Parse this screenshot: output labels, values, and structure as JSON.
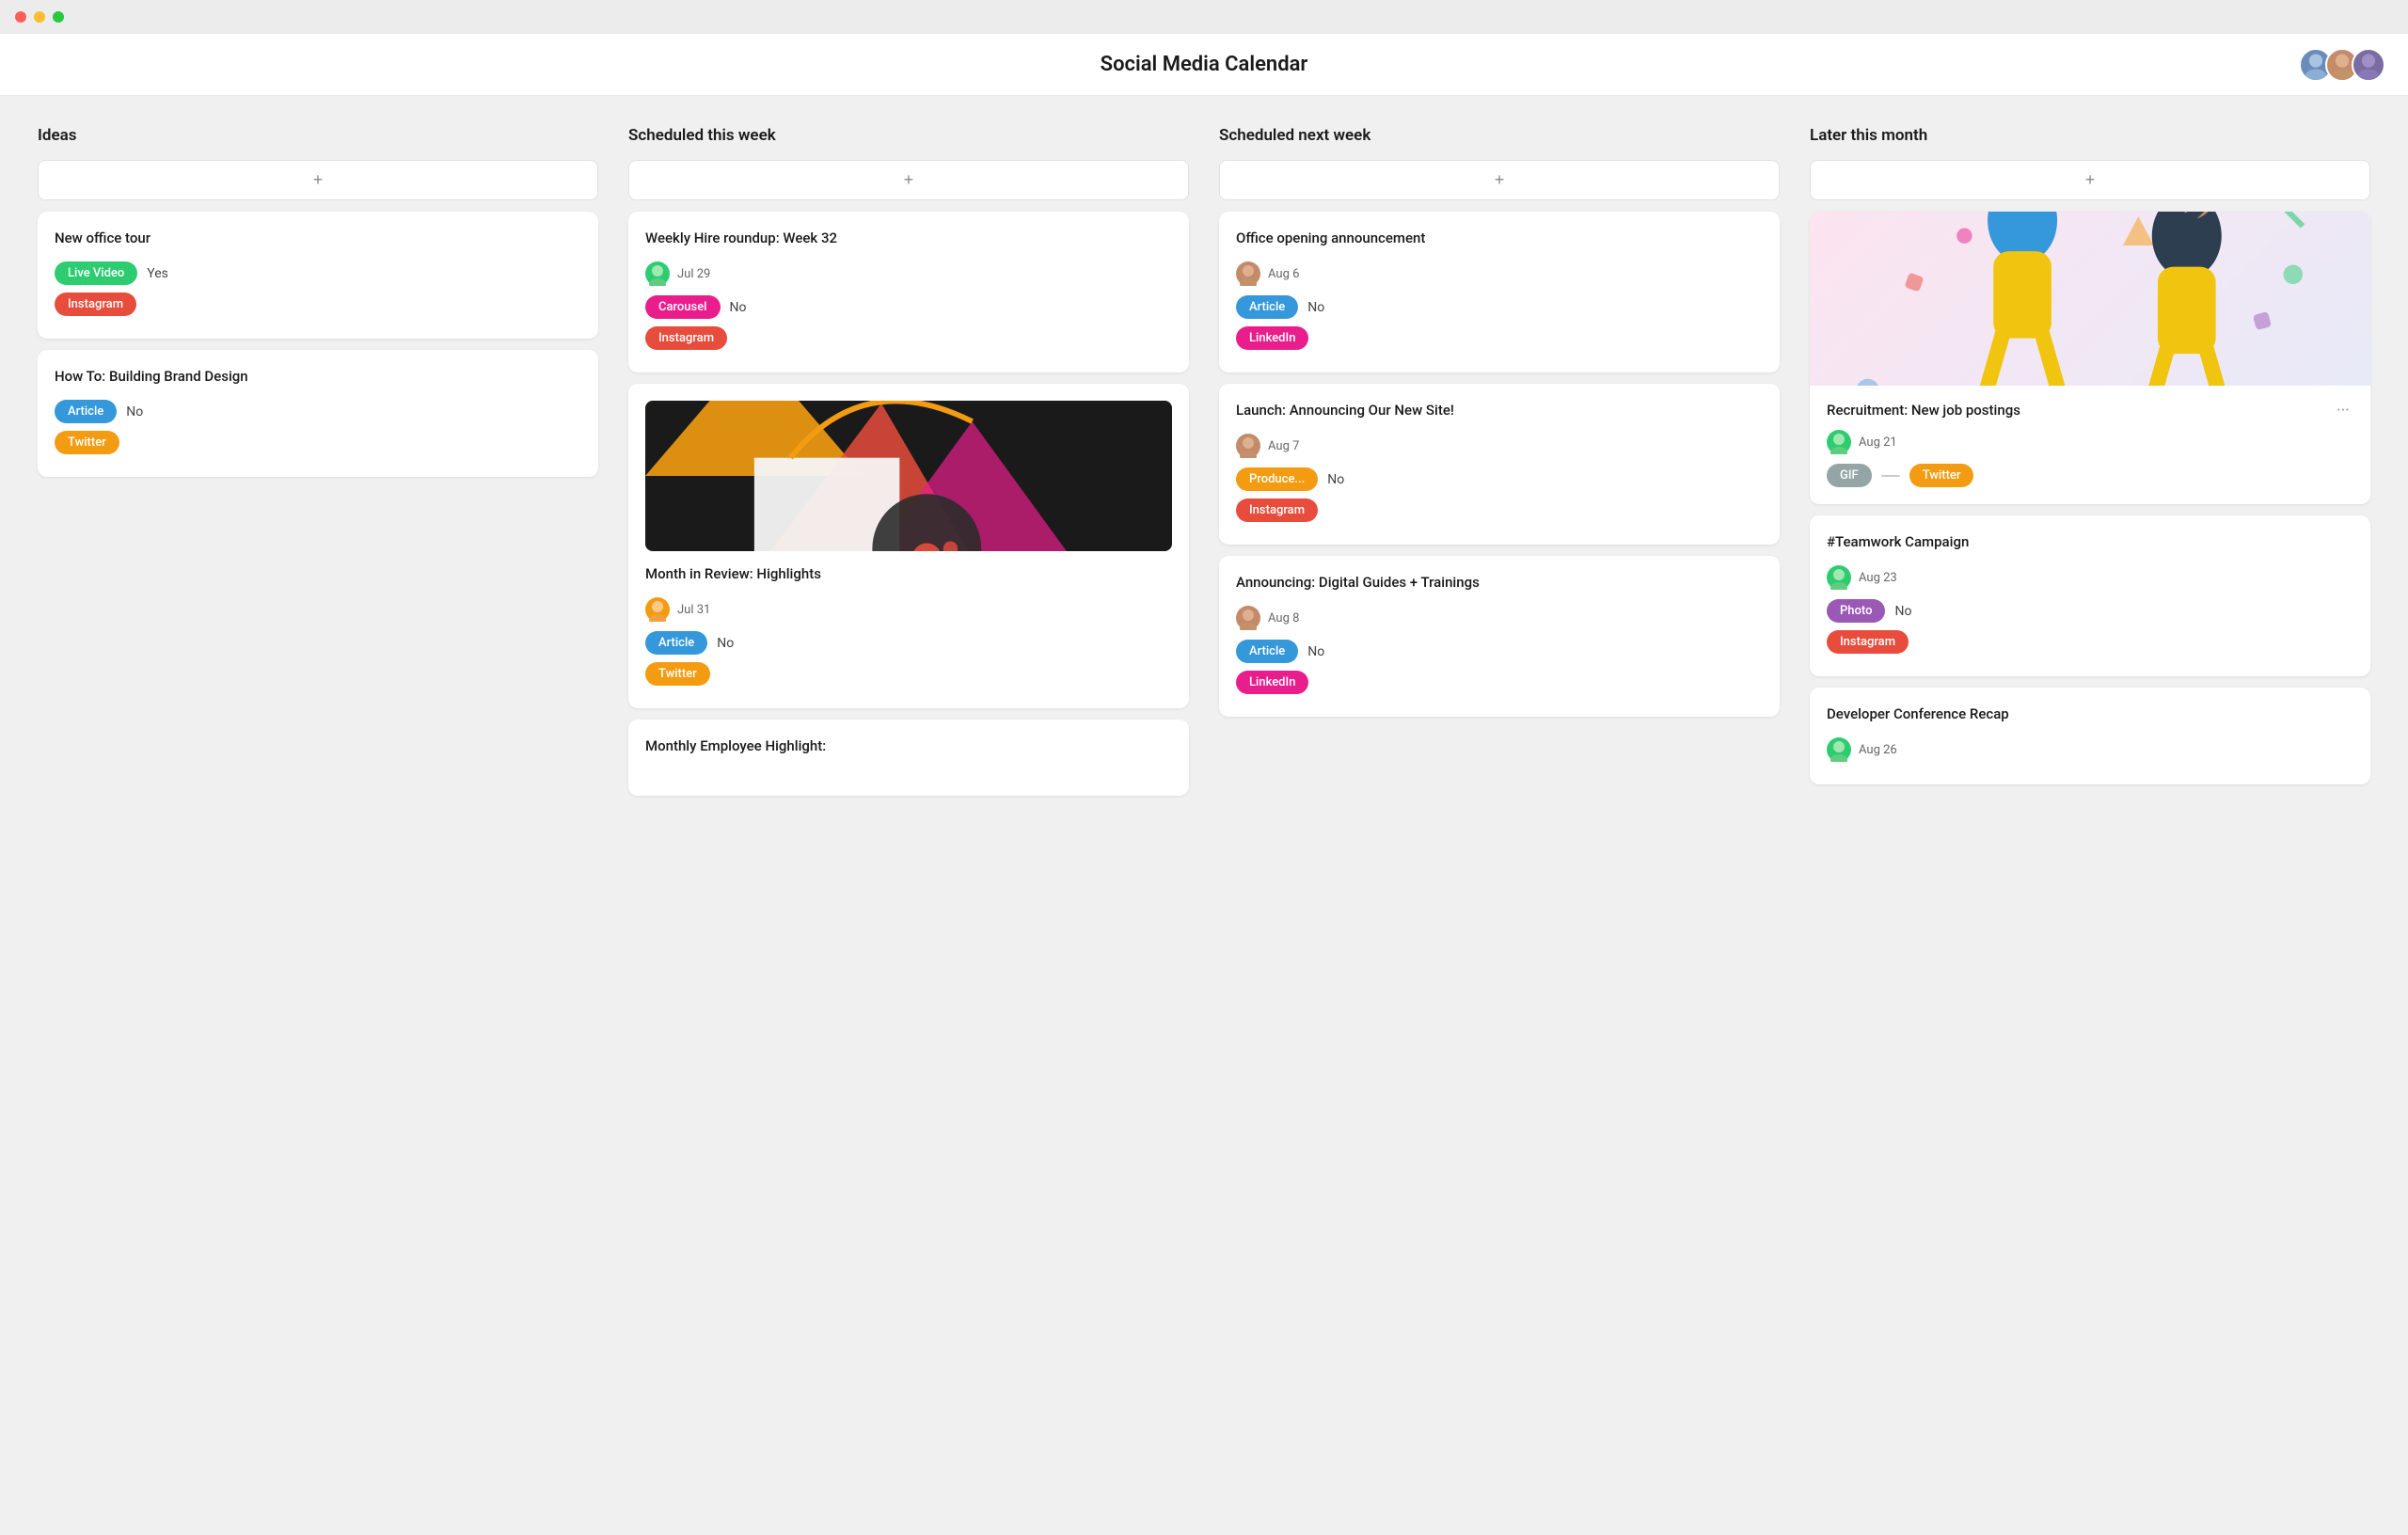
{
  "titlebar": {
    "dots": [
      "red",
      "yellow",
      "green"
    ]
  },
  "header": {
    "title": "Social Media Calendar",
    "avatars": [
      {
        "color": "#6b8cba",
        "label": "A1"
      },
      {
        "color": "#c48a6a",
        "label": "A2"
      },
      {
        "color": "#7a6ba0",
        "label": "A3"
      }
    ]
  },
  "columns": [
    {
      "id": "ideas",
      "title": "Ideas",
      "add_label": "+",
      "cards": [
        {
          "id": "new-office-tour",
          "title": "New office tour",
          "tags": [
            {
              "label": "Live Video",
              "type": "live-video"
            },
            {
              "label": "Instagram",
              "type": "instagram"
            }
          ],
          "boolean_label": "Yes",
          "has_meta": false
        },
        {
          "id": "building-brand",
          "title": "How To: Building Brand Design",
          "tags": [
            {
              "label": "Article",
              "type": "article"
            },
            {
              "label": "Twitter",
              "type": "twitter"
            }
          ],
          "boolean_label": "No",
          "has_meta": false
        }
      ]
    },
    {
      "id": "scheduled-this-week",
      "title": "Scheduled this week",
      "add_label": "+",
      "cards": [
        {
          "id": "weekly-hire",
          "title": "Weekly Hire roundup: Week 32",
          "avatar_color": "#2ecc71",
          "date": "Jul 29",
          "tags": [
            {
              "label": "Carousel",
              "type": "carousel"
            },
            {
              "label": "Instagram",
              "type": "instagram"
            }
          ],
          "boolean_label": "No",
          "has_meta": true,
          "has_image": false
        },
        {
          "id": "month-review",
          "title": "Month in Review: Highlights",
          "avatar_color": "#f39c12",
          "date": "Jul 31",
          "tags": [
            {
              "label": "Article",
              "type": "article"
            },
            {
              "label": "Twitter",
              "type": "twitter"
            }
          ],
          "boolean_label": "No",
          "has_meta": true,
          "has_image": true,
          "image_type": "art1"
        },
        {
          "id": "monthly-employee",
          "title": "Monthly Employee Highlight:",
          "has_meta": false,
          "has_image": false,
          "partial": true
        }
      ]
    },
    {
      "id": "scheduled-next-week",
      "title": "Scheduled next week",
      "add_label": "+",
      "cards": [
        {
          "id": "office-opening",
          "title": "Office opening announcement",
          "avatar_color": "#c48a6a",
          "date": "Aug 6",
          "tags": [
            {
              "label": "Article",
              "type": "article"
            },
            {
              "label": "LinkedIn",
              "type": "linkedin"
            }
          ],
          "boolean_label": "No",
          "has_meta": true
        },
        {
          "id": "launch-new-site",
          "title": "Launch: Announcing Our New Site!",
          "avatar_color": "#c48a6a",
          "date": "Aug 7",
          "tags": [
            {
              "label": "Produce...",
              "type": "produce"
            },
            {
              "label": "Instagram",
              "type": "instagram"
            }
          ],
          "boolean_label": "No",
          "has_meta": true
        },
        {
          "id": "digital-guides",
          "title": "Announcing: Digital Guides + Trainings",
          "avatar_color": "#c48a6a",
          "date": "Aug 8",
          "tags": [
            {
              "label": "Article",
              "type": "article"
            },
            {
              "label": "LinkedIn",
              "type": "linkedin"
            }
          ],
          "boolean_label": "No",
          "has_meta": true,
          "has_image": false
        }
      ]
    },
    {
      "id": "later-this-month",
      "title": "Later this month",
      "add_label": "+",
      "cards": [
        {
          "id": "recruitment",
          "title": "Recruitment: New job postings",
          "avatar_color": "#2ecc71",
          "date": "Aug 21",
          "tags": [
            {
              "label": "GIF",
              "type": "gif"
            },
            {
              "label": "Twitter",
              "type": "twitter"
            }
          ],
          "has_meta": true,
          "has_illustration": true
        },
        {
          "id": "teamwork-campaign",
          "title": "#Teamwork Campaign",
          "avatar_color": "#2ecc71",
          "date": "Aug 23",
          "tags": [
            {
              "label": "Photo",
              "type": "photo"
            },
            {
              "label": "Instagram",
              "type": "instagram"
            }
          ],
          "boolean_label": "No",
          "has_meta": true
        },
        {
          "id": "dev-conference",
          "title": "Developer Conference Recap",
          "avatar_color": "#2ecc71",
          "date": "Aug 26",
          "has_meta": true,
          "has_image": true,
          "image_type": "art2",
          "partial": true
        }
      ]
    }
  ]
}
